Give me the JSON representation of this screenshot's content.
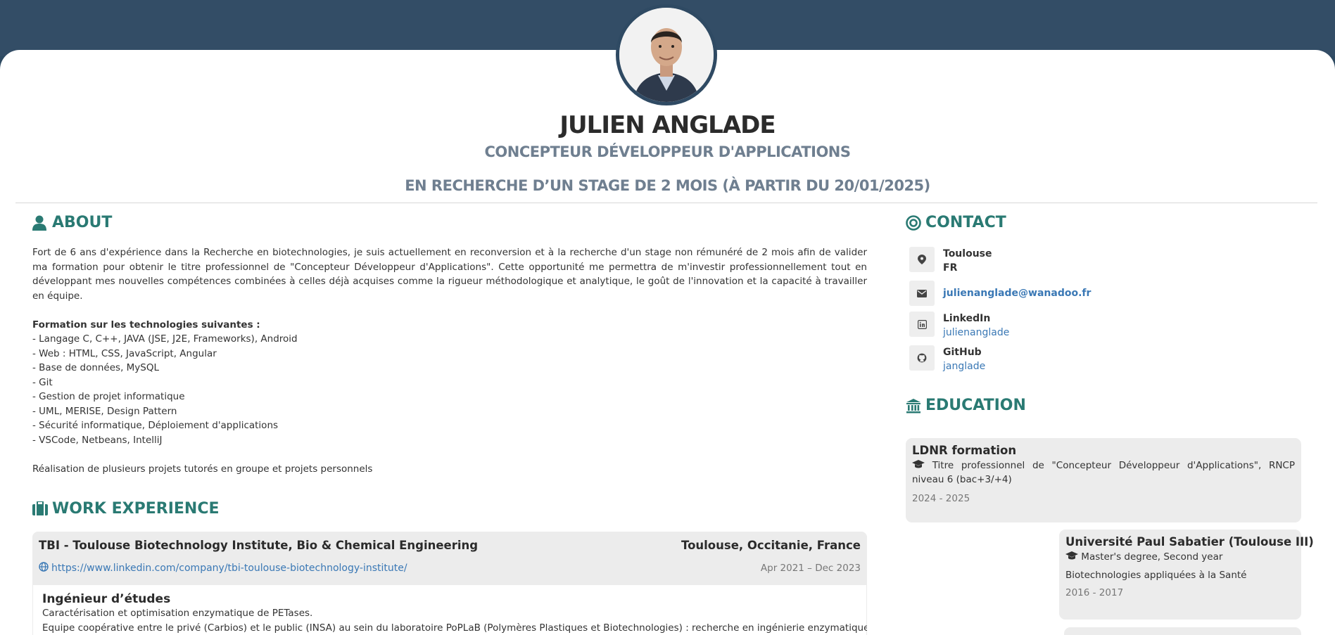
{
  "header": {
    "name": "JULIEN ANGLADE",
    "title": "CONCEPTEUR DÉVELOPPEUR D'APPLICATIONS",
    "search": "EN RECHERCHE D’UN STAGE DE 2 MOIS (À PARTIR DU 20/01/2025)"
  },
  "about": {
    "title": "ABOUT",
    "intro": "Fort de 6 ans d'expérience dans la Recherche en biotechnologies, je suis actuellement en reconversion et à la recherche d'un stage non rémunéré de 2 mois afin de valider ma formation pour obtenir le titre professionnel de \"Concepteur Développeur d'Applications\". Cette opportunité me permettra de m'investir professionnellement tout en développant mes nouvelles compétences combinées à celles déjà acquises comme la rigueur méthodologique et analytique, le goût de l'innovation et la capacité à travailler en équipe.",
    "skills_heading": "Formation sur les technologies suivantes :",
    "skills": [
      "- Langage C, C++, JAVA (JSE, J2E, Frameworks), Android",
      "- Web : HTML, CSS, JavaScript, Angular",
      "- Base de données, MySQL",
      "- Git",
      "- Gestion de projet informatique",
      "- UML, MERISE, Design Pattern",
      "- Sécurité informatique, Déploiement d'applications",
      "- VSCode, Netbeans, IntelliJ"
    ],
    "outro": "Réalisation de plusieurs projets tutorés en groupe et projets personnels"
  },
  "work": {
    "title": "WORK EXPERIENCE",
    "company": "TBI - Toulouse Biotechnology Institute, Bio & Chemical Engineering",
    "location": "Toulouse, Occitanie, France",
    "url": "https://www.linkedin.com/company/tbi-toulouse-biotechnology-institute/",
    "dates": "Apr 2021 – Dec 2023",
    "role": "Ingénieur d’études",
    "line1": "Caractérisation et optimisation enzymatique de PETases.",
    "line2": "Equipe coopérative entre le privé (Carbios) et le public (INSA) au sein du laboratoire PoPLaB (Polymères Plastiques et Biotechnologies) : recherche en ingénierie enzymatique"
  },
  "contact": {
    "title": "CONTACT",
    "city": "Toulouse",
    "country": "FR",
    "email": "julienanglade@wanadoo.fr",
    "linkedin_label": "LinkedIn",
    "linkedin_value": "julienanglade",
    "github_label": "GitHub",
    "github_value": "janglade"
  },
  "education": {
    "title": "EDUCATION",
    "items": [
      {
        "school": "LDNR formation",
        "degree": "Titre professionnel de \"Concepteur Développeur d'Applications\", RNCP niveau 6 (bac+3/+4)",
        "years": "2024 - 2025"
      },
      {
        "school": "Université Paul Sabatier (Toulouse III)",
        "degree": "Master's degree, Second year",
        "field": "Biotechnologies appliquées à la Santé",
        "years": "2016 - 2017"
      }
    ]
  },
  "colors": {
    "header_bg": "#334d66",
    "accent": "#2a7a73",
    "link": "#3a78b5"
  }
}
